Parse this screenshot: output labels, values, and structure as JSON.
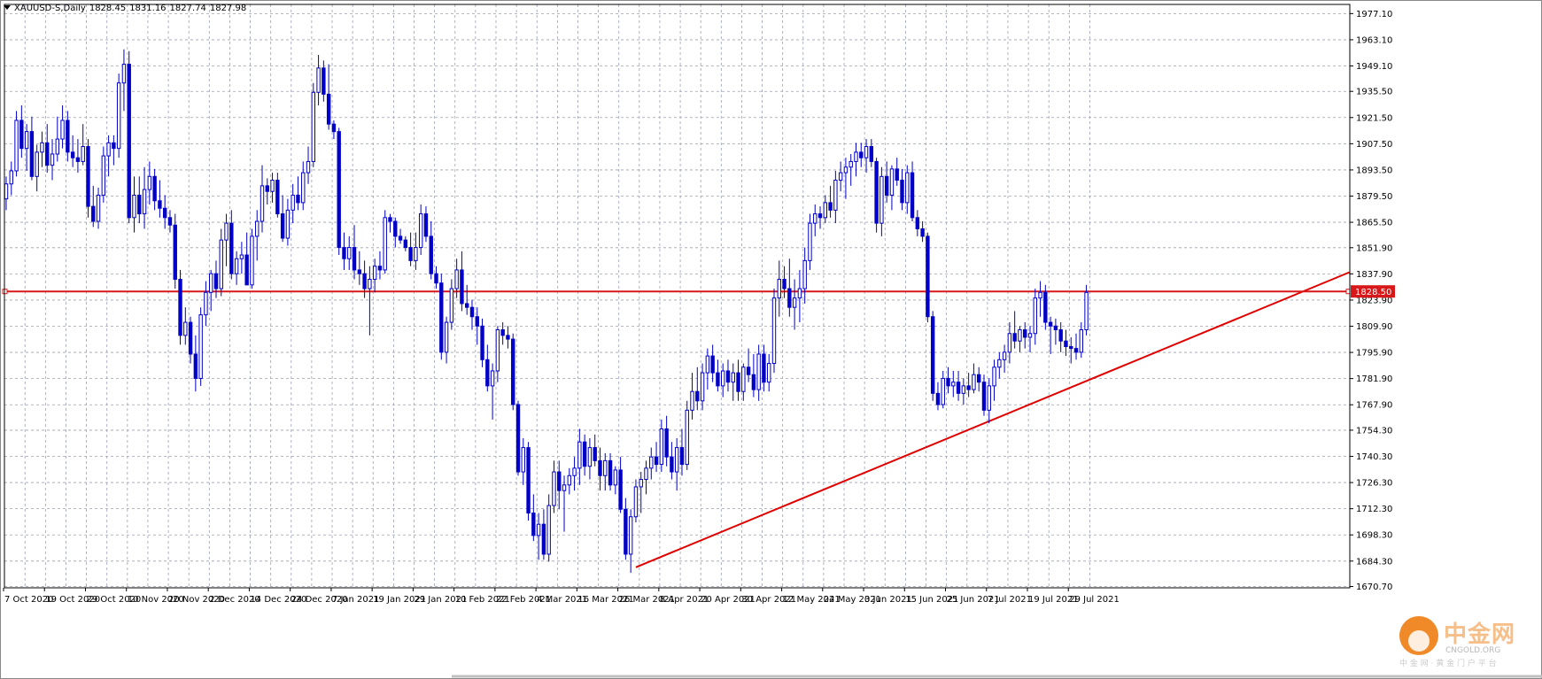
{
  "header": {
    "symbol": "XAUUSD-S,Daily",
    "open": "1828.45",
    "high": "1831.16",
    "low": "1827.74",
    "close": "1827.98"
  },
  "watermark": {
    "brand": "中金网",
    "url": "CNGOLD.ORG",
    "tagline": "中 金 网 · 黄 金 门 户 平 台"
  },
  "price_marker": "1828.50",
  "colors": {
    "candle": "#0000c8",
    "grid": "#9aa0b4",
    "trendline": "#e00000",
    "hline": "#d81818",
    "brand": "#f08a28"
  },
  "chart_data": {
    "type": "candlestick",
    "title": "XAUUSD-S,Daily",
    "ylim": [
      1670,
      1982
    ],
    "y_ticks": [
      "1977.10",
      "1963.10",
      "1949.10",
      "1935.50",
      "1921.50",
      "1907.50",
      "1893.50",
      "1879.50",
      "1865.50",
      "1851.90",
      "1837.90",
      "1823.90",
      "1809.90",
      "1795.90",
      "1781.90",
      "1767.90",
      "1754.30",
      "1740.30",
      "1726.30",
      "1712.30",
      "1698.30",
      "1684.30",
      "1670.70"
    ],
    "x_labels": [
      "7 Oct 2020",
      "19 Oct 2020",
      "29 Oct 2020",
      "10 Nov 2020",
      "20 Nov 2020",
      "2 Dec 2020",
      "14 Dec 2020",
      "24 Dec 2020",
      "7 Jan 2021",
      "19 Jan 2021",
      "29 Jan 2021",
      "10 Feb 2021",
      "22 Feb 2021",
      "4 Mar 2021",
      "16 Mar 2021",
      "26 Mar 2021",
      "8 Apr 2021",
      "20 Apr 2021",
      "30 Apr 2021",
      "12 May 2021",
      "24 May 2021",
      "3 Jun 2021",
      "15 Jun 2021",
      "25 Jun 2021",
      "7 Jul 2021",
      "19 Jul 2021",
      "29 Jul 2021"
    ],
    "x_label_bar_index": [
      0,
      8,
      16,
      24,
      32,
      40,
      48,
      56,
      64,
      72,
      80,
      88,
      96,
      104,
      112,
      120,
      128,
      136,
      144,
      152,
      160,
      168,
      176,
      184,
      192,
      200,
      208
    ],
    "horizontal_line": 1828.5,
    "trendline": {
      "from": {
        "bar": 123,
        "price": 1681
      },
      "to": {
        "bar": 214,
        "price": 1784
      }
    },
    "candles": [
      [
        1878,
        1890,
        1872,
        1886
      ],
      [
        1886,
        1898,
        1880,
        1893
      ],
      [
        1893,
        1925,
        1890,
        1920
      ],
      [
        1920,
        1928,
        1900,
        1905
      ],
      [
        1905,
        1918,
        1893,
        1914
      ],
      [
        1914,
        1922,
        1888,
        1890
      ],
      [
        1890,
        1907,
        1882,
        1903
      ],
      [
        1903,
        1914,
        1895,
        1908
      ],
      [
        1908,
        1918,
        1892,
        1896
      ],
      [
        1896,
        1910,
        1888,
        1902
      ],
      [
        1902,
        1922,
        1898,
        1910
      ],
      [
        1910,
        1928,
        1905,
        1920
      ],
      [
        1920,
        1925,
        1898,
        1903
      ],
      [
        1903,
        1912,
        1895,
        1900
      ],
      [
        1900,
        1910,
        1892,
        1898
      ],
      [
        1898,
        1918,
        1896,
        1906
      ],
      [
        1906,
        1910,
        1868,
        1874
      ],
      [
        1874,
        1885,
        1863,
        1866
      ],
      [
        1866,
        1884,
        1862,
        1880
      ],
      [
        1880,
        1906,
        1876,
        1901
      ],
      [
        1901,
        1912,
        1890,
        1908
      ],
      [
        1908,
        1912,
        1896,
        1905
      ],
      [
        1905,
        1945,
        1900,
        1940
      ],
      [
        1940,
        1958,
        1925,
        1950
      ],
      [
        1950,
        1957,
        1865,
        1868
      ],
      [
        1868,
        1890,
        1860,
        1880
      ],
      [
        1880,
        1890,
        1865,
        1870
      ],
      [
        1870,
        1895,
        1862,
        1883
      ],
      [
        1883,
        1898,
        1875,
        1890
      ],
      [
        1890,
        1894,
        1872,
        1877
      ],
      [
        1877,
        1888,
        1868,
        1873
      ],
      [
        1873,
        1880,
        1862,
        1868
      ],
      [
        1868,
        1872,
        1860,
        1864
      ],
      [
        1864,
        1870,
        1830,
        1835
      ],
      [
        1835,
        1840,
        1800,
        1805
      ],
      [
        1805,
        1820,
        1800,
        1812
      ],
      [
        1812,
        1815,
        1790,
        1795
      ],
      [
        1795,
        1805,
        1775,
        1782
      ],
      [
        1782,
        1820,
        1778,
        1816
      ],
      [
        1816,
        1834,
        1810,
        1828
      ],
      [
        1828,
        1840,
        1818,
        1838
      ],
      [
        1838,
        1845,
        1825,
        1830
      ],
      [
        1830,
        1862,
        1826,
        1856
      ],
      [
        1856,
        1870,
        1842,
        1865
      ],
      [
        1865,
        1872,
        1835,
        1838
      ],
      [
        1838,
        1850,
        1832,
        1846
      ],
      [
        1846,
        1855,
        1838,
        1848
      ],
      [
        1848,
        1860,
        1840,
        1832
      ],
      [
        1832,
        1862,
        1830,
        1858
      ],
      [
        1858,
        1872,
        1845,
        1866
      ],
      [
        1866,
        1896,
        1860,
        1885
      ],
      [
        1885,
        1889,
        1875,
        1882
      ],
      [
        1882,
        1892,
        1876,
        1888
      ],
      [
        1888,
        1892,
        1868,
        1870
      ],
      [
        1870,
        1880,
        1855,
        1857
      ],
      [
        1857,
        1878,
        1853,
        1872
      ],
      [
        1872,
        1886,
        1865,
        1880
      ],
      [
        1880,
        1890,
        1872,
        1876
      ],
      [
        1876,
        1898,
        1872,
        1892
      ],
      [
        1892,
        1906,
        1886,
        1898
      ],
      [
        1898,
        1940,
        1895,
        1935
      ],
      [
        1935,
        1955,
        1928,
        1948
      ],
      [
        1948,
        1952,
        1930,
        1934
      ],
      [
        1934,
        1950,
        1915,
        1918
      ],
      [
        1918,
        1920,
        1910,
        1914
      ],
      [
        1914,
        1916,
        1848,
        1852
      ],
      [
        1852,
        1860,
        1840,
        1846
      ],
      [
        1846,
        1858,
        1840,
        1852
      ],
      [
        1852,
        1864,
        1835,
        1840
      ],
      [
        1840,
        1850,
        1832,
        1838
      ],
      [
        1838,
        1845,
        1825,
        1830
      ],
      [
        1830,
        1842,
        1805,
        1835
      ],
      [
        1835,
        1846,
        1828,
        1842
      ],
      [
        1842,
        1850,
        1835,
        1840
      ],
      [
        1840,
        1872,
        1838,
        1868
      ],
      [
        1868,
        1870,
        1860,
        1866
      ],
      [
        1866,
        1868,
        1852,
        1858
      ],
      [
        1858,
        1862,
        1854,
        1856
      ],
      [
        1856,
        1858,
        1850,
        1852
      ],
      [
        1852,
        1860,
        1842,
        1845
      ],
      [
        1845,
        1860,
        1840,
        1852
      ],
      [
        1852,
        1875,
        1848,
        1870
      ],
      [
        1870,
        1874,
        1855,
        1858
      ],
      [
        1858,
        1866,
        1835,
        1838
      ],
      [
        1838,
        1842,
        1830,
        1833
      ],
      [
        1833,
        1838,
        1792,
        1796
      ],
      [
        1796,
        1815,
        1790,
        1812
      ],
      [
        1812,
        1835,
        1808,
        1830
      ],
      [
        1830,
        1846,
        1825,
        1840
      ],
      [
        1840,
        1850,
        1818,
        1822
      ],
      [
        1822,
        1832,
        1816,
        1820
      ],
      [
        1820,
        1824,
        1808,
        1815
      ],
      [
        1815,
        1820,
        1800,
        1810
      ],
      [
        1810,
        1814,
        1788,
        1792
      ],
      [
        1792,
        1800,
        1775,
        1778
      ],
      [
        1778,
        1790,
        1760,
        1786
      ],
      [
        1786,
        1810,
        1780,
        1808
      ],
      [
        1808,
        1812,
        1800,
        1805
      ],
      [
        1805,
        1810,
        1798,
        1803
      ],
      [
        1803,
        1806,
        1765,
        1768
      ],
      [
        1768,
        1770,
        1730,
        1732
      ],
      [
        1732,
        1750,
        1725,
        1745
      ],
      [
        1745,
        1748,
        1706,
        1710
      ],
      [
        1710,
        1720,
        1695,
        1698
      ],
      [
        1698,
        1710,
        1685,
        1704
      ],
      [
        1704,
        1712,
        1685,
        1688
      ],
      [
        1688,
        1720,
        1684,
        1714
      ],
      [
        1714,
        1738,
        1710,
        1732
      ],
      [
        1732,
        1738,
        1712,
        1722
      ],
      [
        1722,
        1730,
        1700,
        1725
      ],
      [
        1725,
        1734,
        1720,
        1730
      ],
      [
        1730,
        1740,
        1722,
        1734
      ],
      [
        1734,
        1755,
        1725,
        1748
      ],
      [
        1748,
        1752,
        1730,
        1735
      ],
      [
        1735,
        1750,
        1728,
        1745
      ],
      [
        1745,
        1752,
        1735,
        1738
      ],
      [
        1738,
        1745,
        1722,
        1730
      ],
      [
        1730,
        1742,
        1722,
        1738
      ],
      [
        1738,
        1742,
        1722,
        1725
      ],
      [
        1725,
        1735,
        1720,
        1733
      ],
      [
        1733,
        1740,
        1710,
        1712
      ],
      [
        1712,
        1718,
        1685,
        1688
      ],
      [
        1688,
        1712,
        1678,
        1708
      ],
      [
        1708,
        1728,
        1705,
        1724
      ],
      [
        1724,
        1732,
        1710,
        1728
      ],
      [
        1728,
        1738,
        1720,
        1734
      ],
      [
        1734,
        1745,
        1728,
        1740
      ],
      [
        1740,
        1748,
        1732,
        1736
      ],
      [
        1736,
        1760,
        1732,
        1755
      ],
      [
        1755,
        1762,
        1735,
        1740
      ],
      [
        1740,
        1748,
        1728,
        1732
      ],
      [
        1732,
        1750,
        1722,
        1745
      ],
      [
        1745,
        1755,
        1730,
        1736
      ],
      [
        1736,
        1770,
        1733,
        1765
      ],
      [
        1765,
        1785,
        1760,
        1775
      ],
      [
        1775,
        1788,
        1765,
        1770
      ],
      [
        1770,
        1790,
        1765,
        1785
      ],
      [
        1785,
        1798,
        1776,
        1794
      ],
      [
        1794,
        1800,
        1780,
        1785
      ],
      [
        1785,
        1792,
        1775,
        1778
      ],
      [
        1778,
        1790,
        1772,
        1786
      ],
      [
        1786,
        1792,
        1775,
        1780
      ],
      [
        1780,
        1790,
        1770,
        1785
      ],
      [
        1785,
        1792,
        1770,
        1775
      ],
      [
        1775,
        1790,
        1770,
        1788
      ],
      [
        1788,
        1798,
        1780,
        1784
      ],
      [
        1784,
        1795,
        1772,
        1776
      ],
      [
        1776,
        1800,
        1770,
        1795
      ],
      [
        1795,
        1800,
        1775,
        1780
      ],
      [
        1780,
        1795,
        1775,
        1790
      ],
      [
        1790,
        1830,
        1785,
        1825
      ],
      [
        1825,
        1845,
        1815,
        1835
      ],
      [
        1835,
        1842,
        1825,
        1830
      ],
      [
        1830,
        1846,
        1815,
        1820
      ],
      [
        1820,
        1835,
        1808,
        1825
      ],
      [
        1825,
        1840,
        1812,
        1830
      ],
      [
        1830,
        1852,
        1822,
        1845
      ],
      [
        1845,
        1870,
        1840,
        1865
      ],
      [
        1865,
        1875,
        1858,
        1870
      ],
      [
        1870,
        1874,
        1862,
        1868
      ],
      [
        1868,
        1880,
        1865,
        1876
      ],
      [
        1876,
        1885,
        1868,
        1872
      ],
      [
        1872,
        1893,
        1865,
        1888
      ],
      [
        1888,
        1898,
        1882,
        1892
      ],
      [
        1892,
        1900,
        1878,
        1895
      ],
      [
        1895,
        1902,
        1885,
        1898
      ],
      [
        1898,
        1908,
        1890,
        1903
      ],
      [
        1903,
        1908,
        1895,
        1900
      ],
      [
        1900,
        1910,
        1892,
        1906
      ],
      [
        1906,
        1910,
        1895,
        1898
      ],
      [
        1898,
        1900,
        1860,
        1865
      ],
      [
        1865,
        1895,
        1858,
        1890
      ],
      [
        1890,
        1898,
        1876,
        1880
      ],
      [
        1880,
        1896,
        1872,
        1894
      ],
      [
        1894,
        1900,
        1885,
        1888
      ],
      [
        1888,
        1894,
        1872,
        1876
      ],
      [
        1876,
        1896,
        1870,
        1892
      ],
      [
        1892,
        1898,
        1866,
        1868
      ],
      [
        1868,
        1872,
        1858,
        1862
      ],
      [
        1862,
        1866,
        1855,
        1858
      ],
      [
        1858,
        1860,
        1812,
        1815
      ],
      [
        1815,
        1818,
        1770,
        1774
      ],
      [
        1774,
        1780,
        1765,
        1768
      ],
      [
        1768,
        1786,
        1766,
        1782
      ],
      [
        1782,
        1788,
        1774,
        1778
      ],
      [
        1778,
        1786,
        1772,
        1780
      ],
      [
        1780,
        1786,
        1770,
        1774
      ],
      [
        1774,
        1782,
        1768,
        1778
      ],
      [
        1778,
        1785,
        1772,
        1776
      ],
      [
        1776,
        1790,
        1774,
        1784
      ],
      [
        1784,
        1788,
        1775,
        1780
      ],
      [
        1780,
        1784,
        1762,
        1765
      ],
      [
        1765,
        1782,
        1758,
        1778
      ],
      [
        1778,
        1792,
        1770,
        1788
      ],
      [
        1788,
        1796,
        1782,
        1792
      ],
      [
        1792,
        1800,
        1785,
        1796
      ],
      [
        1796,
        1812,
        1790,
        1806
      ],
      [
        1806,
        1818,
        1798,
        1802
      ],
      [
        1802,
        1810,
        1796,
        1808
      ],
      [
        1808,
        1812,
        1798,
        1804
      ],
      [
        1804,
        1810,
        1796,
        1806
      ],
      [
        1806,
        1830,
        1800,
        1825
      ],
      [
        1825,
        1834,
        1815,
        1828
      ],
      [
        1828,
        1832,
        1808,
        1812
      ],
      [
        1812,
        1815,
        1795,
        1810
      ],
      [
        1810,
        1814,
        1800,
        1808
      ],
      [
        1808,
        1812,
        1796,
        1802
      ],
      [
        1802,
        1808,
        1794,
        1799
      ],
      [
        1799,
        1804,
        1790,
        1798
      ],
      [
        1798,
        1806,
        1792,
        1796
      ],
      [
        1796,
        1812,
        1793,
        1808
      ],
      [
        1808,
        1832,
        1805,
        1828
      ]
    ]
  }
}
